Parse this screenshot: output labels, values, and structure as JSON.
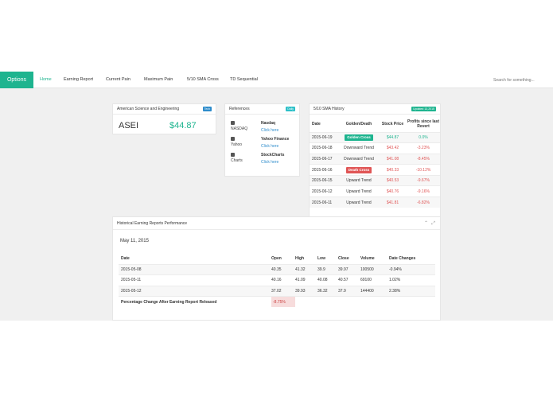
{
  "navbar": {
    "brand": "Options",
    "items": [
      "Home",
      "Earning Report",
      "Current Pain",
      "Maximum Pain",
      "5/10 SMA Cross",
      "TD Sequential"
    ],
    "search_placeholder": "Search for something..."
  },
  "stock_panel": {
    "title": "American Science and Engineering",
    "badge": "Tech",
    "ticker": "ASEI",
    "price": "$44.87"
  },
  "references": {
    "title": "References",
    "badge": "Daily",
    "items": [
      {
        "icon": "bank-icon",
        "source": "NASDAQ",
        "name": "Nasdaq",
        "link": "Click here"
      },
      {
        "icon": "document-icon",
        "source": "Yahoo",
        "name": "Yahoo Finance",
        "link": "Click here"
      },
      {
        "icon": "chart-icon",
        "source": "Charts",
        "name": "StockCharts",
        "link": "Click here"
      }
    ]
  },
  "sma": {
    "title": "5/10 SMA History",
    "badge": "Updated 13,2015",
    "headers": [
      "Date",
      "Golden/Death",
      "Stock Price",
      "Profits since last Revert"
    ],
    "rows": [
      {
        "date": "2015-06-19",
        "signal": "Golden Cross",
        "signal_type": "golden",
        "price": "$44.87",
        "profit": "0.0%",
        "positive": true
      },
      {
        "date": "2015-06-18",
        "signal": "Downward Trend",
        "signal_type": "text",
        "price": "$43.42",
        "profit": "-3.23%",
        "positive": false
      },
      {
        "date": "2015-06-17",
        "signal": "Downward Trend",
        "signal_type": "text",
        "price": "$41.08",
        "profit": "-8.45%",
        "positive": false
      },
      {
        "date": "2015-06-16",
        "signal": "Death Cross",
        "signal_type": "death",
        "price": "$40.33",
        "profit": "-10.12%",
        "positive": false
      },
      {
        "date": "2015-06-15",
        "signal": "Upward Trend",
        "signal_type": "text",
        "price": "$40.53",
        "profit": "-9.67%",
        "positive": false
      },
      {
        "date": "2015-06-12",
        "signal": "Upward Trend",
        "signal_type": "text",
        "price": "$40.76",
        "profit": "-9.16%",
        "positive": false
      },
      {
        "date": "2015-06-11",
        "signal": "Upward Trend",
        "signal_type": "text",
        "price": "$41.81",
        "profit": "-6.82%",
        "positive": false
      }
    ]
  },
  "history": {
    "title": "Historical Earning Reports Performance",
    "date_heading": "May 11, 2015",
    "headers": [
      "Date",
      "Open",
      "High",
      "Low",
      "Close",
      "Volume",
      "Date Changes"
    ],
    "rows": [
      [
        "2015-05-08",
        "40.35",
        "41.32",
        "39.9",
        "39.97",
        "100500",
        "-0.94%"
      ],
      [
        "2015-05-11",
        "40.16",
        "41.09",
        "40.08",
        "40.57",
        "69100",
        "1.02%"
      ],
      [
        "2015-05-12",
        "37.02",
        "39.93",
        "36.32",
        "37.9",
        "144400",
        "2.38%"
      ]
    ],
    "summary_label": "Percentage Change After Earning Report Released",
    "summary_value": "-8.75%"
  },
  "colors": {
    "accent": "#1eb48f",
    "negative": "#e05555",
    "link": "#2d8ccb"
  }
}
